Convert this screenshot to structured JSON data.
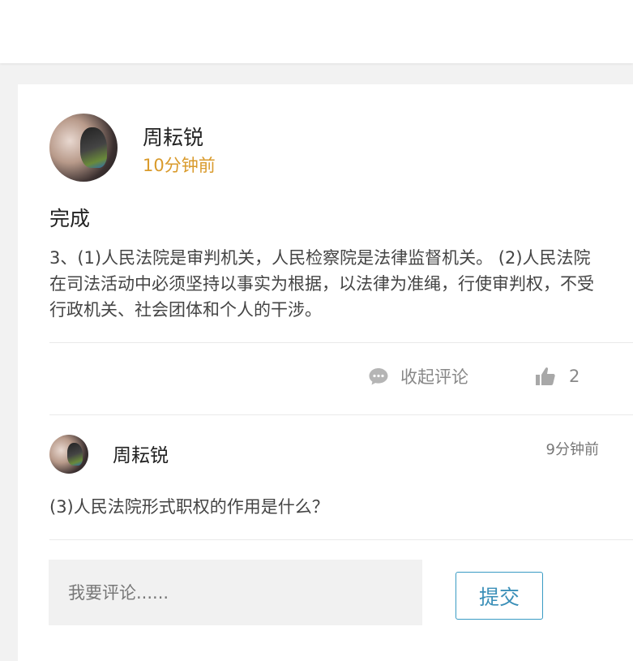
{
  "post": {
    "author": "周耘锐",
    "time": "10分钟前",
    "title": "完成",
    "body": "3、(1)人民法院是审判机关，人民检察院是法律监督机关。 (2)人民法院在司法活动中必须坚持以事实为根据，以法律为准绳，行使审判权，不受行政机关、社会团体和个人的干涉。",
    "avatar_icon": "user-avatar-photo"
  },
  "actions": {
    "collapse_label": "收起评论",
    "collapse_icon": "chat-bubble-icon",
    "like_icon": "thumbs-up-icon",
    "like_count": "2"
  },
  "reply": {
    "author": "周耘锐",
    "time": "9分钟前",
    "text": "(3)人民法院形式职权的作用是什么？",
    "avatar_icon": "user-avatar-photo"
  },
  "comment_box": {
    "placeholder": "我要评论......",
    "submit_label": "提交"
  },
  "colors": {
    "time_accent": "#d99a2b",
    "submit_border": "#3a9bc4",
    "icon_gray": "#b5b5b5"
  }
}
